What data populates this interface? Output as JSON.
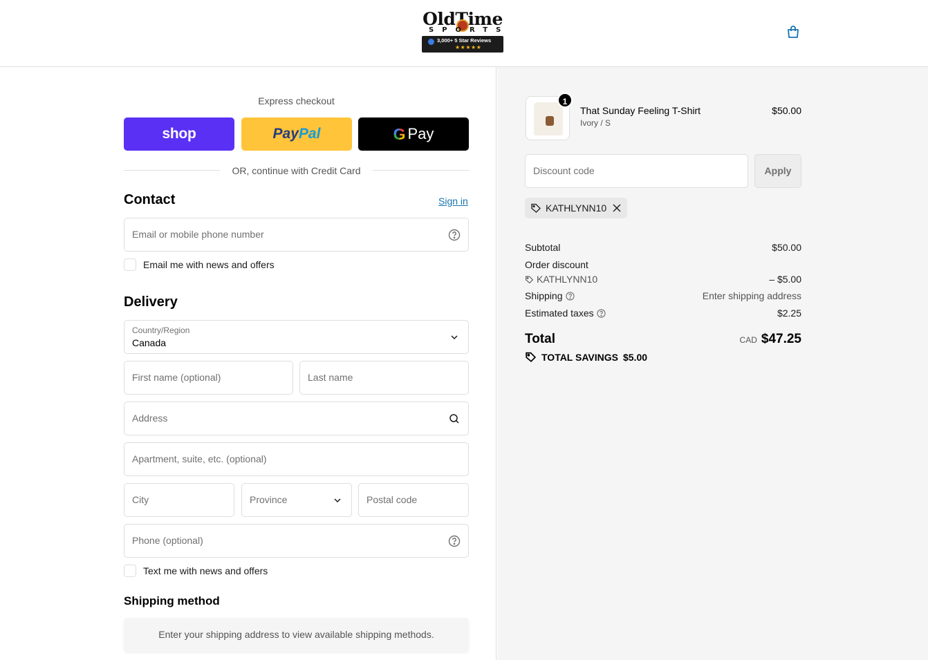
{
  "brand": {
    "title": "OldTime",
    "subtitle": "SPORTS",
    "reviews": "3,000+ 5 Star Reviews",
    "stars": "★★★★★"
  },
  "express": {
    "label": "Express checkout",
    "shop_label": "shop",
    "paypal_label_1": "Pay",
    "paypal_label_2": "Pal",
    "gpay_g": "G",
    "gpay_label": "Pay",
    "divider_text": "OR, continue with Credit Card"
  },
  "contact": {
    "title": "Contact",
    "signin": "Sign in",
    "email_placeholder": "Email or mobile phone number",
    "news_label": "Email me with news and offers"
  },
  "delivery": {
    "title": "Delivery",
    "country_label": "Country/Region",
    "country_value": "Canada",
    "first_name_placeholder": "First name (optional)",
    "last_name_placeholder": "Last name",
    "address_placeholder": "Address",
    "apartment_placeholder": "Apartment, suite, etc. (optional)",
    "city_placeholder": "City",
    "province_placeholder": "Province",
    "postal_placeholder": "Postal code",
    "phone_placeholder": "Phone (optional)",
    "text_label": "Text me with news and offers"
  },
  "shipping_method": {
    "title": "Shipping method",
    "message": "Enter your shipping address to view available shipping methods."
  },
  "summary": {
    "item": {
      "quantity": "1",
      "name": "That Sunday Feeling T-Shirt",
      "variant": "Ivory / S",
      "price": "$50.00"
    },
    "discount_placeholder": "Discount code",
    "apply_label": "Apply",
    "applied_code": "KATHLYNN10",
    "subtotal_label": "Subtotal",
    "subtotal_value": "$50.00",
    "order_discount_label": "Order discount",
    "order_discount_code": "KATHLYNN10",
    "order_discount_value": "– $5.00",
    "shipping_label": "Shipping",
    "shipping_value": "Enter shipping address",
    "taxes_label": "Estimated taxes",
    "taxes_value": "$2.25",
    "total_label": "Total",
    "total_currency": "CAD",
    "total_value": "$47.25",
    "savings_label": "TOTAL SAVINGS",
    "savings_value": "$5.00"
  },
  "colors": {
    "accent": "#1773b0",
    "shop_pay": "#5a31f4",
    "paypal": "#ffc439",
    "summary_bg": "#f5f5f5"
  }
}
